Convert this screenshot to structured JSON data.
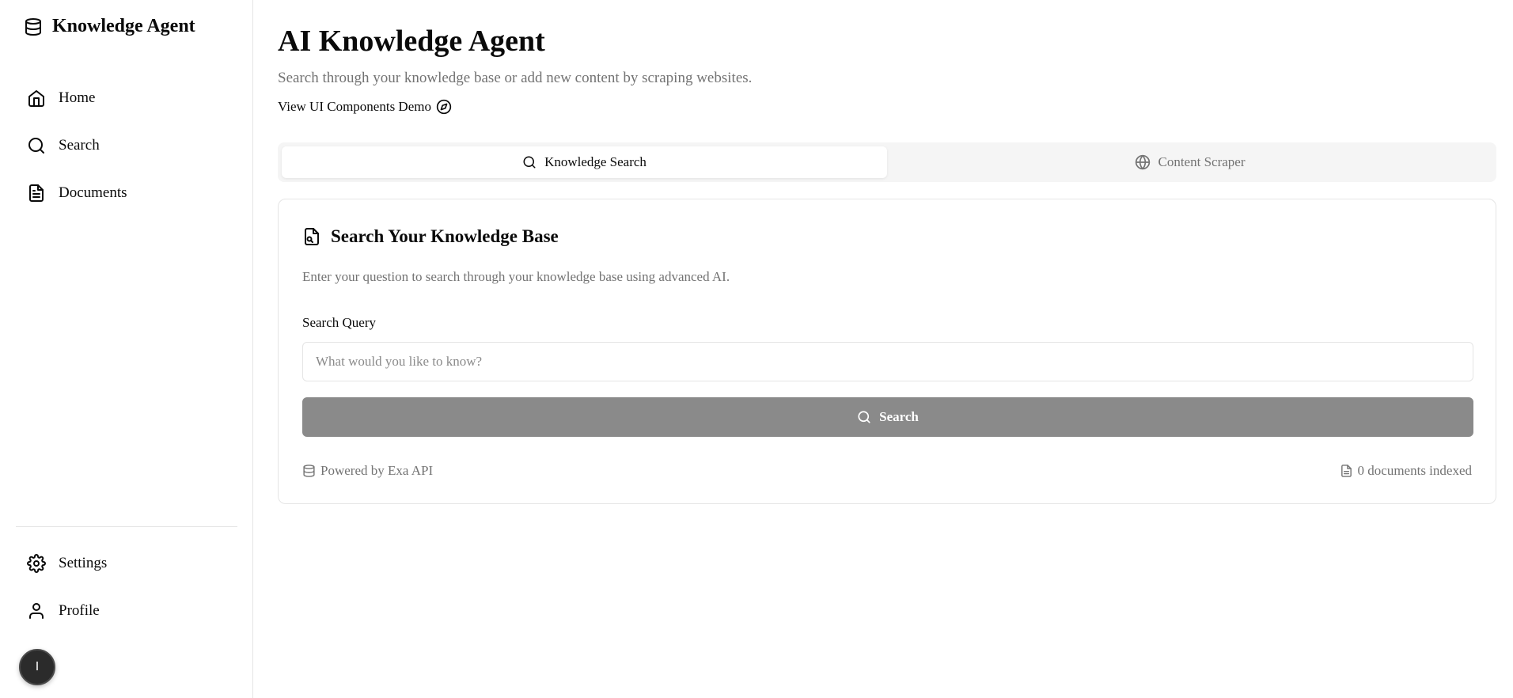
{
  "sidebar": {
    "brand": {
      "title": "Knowledge Agent",
      "icon": "database-icon"
    },
    "nav": [
      {
        "label": "Home",
        "icon": "home-icon"
      },
      {
        "label": "Search",
        "icon": "search-icon"
      },
      {
        "label": "Documents",
        "icon": "document-icon"
      }
    ],
    "bottom_nav": [
      {
        "label": "Settings",
        "icon": "gear-icon"
      },
      {
        "label": "Profile",
        "icon": "user-icon"
      }
    ],
    "avatar_initial": "I"
  },
  "header": {
    "title": "AI Knowledge Agent",
    "subtitle": "Search through your knowledge base or add new content by scraping websites.",
    "demo_link": "View UI Components Demo"
  },
  "tabs": [
    {
      "label": "Knowledge Search",
      "icon": "search-icon",
      "active": true
    },
    {
      "label": "Content Scraper",
      "icon": "globe-icon",
      "active": false
    }
  ],
  "search_card": {
    "title": "Search Your Knowledge Base",
    "description": "Enter your question to search through your knowledge base using advanced AI.",
    "field_label": "Search Query",
    "input_value": "",
    "input_placeholder": "What would you like to know?",
    "button_label": "Search",
    "footer_left": "Powered by Exa API",
    "footer_right": "0 documents indexed"
  },
  "colors": {
    "button_bg": "#8a8a8a",
    "muted_text": "#737373",
    "border": "#e5e5e5",
    "tab_bg": "#f5f5f5"
  }
}
